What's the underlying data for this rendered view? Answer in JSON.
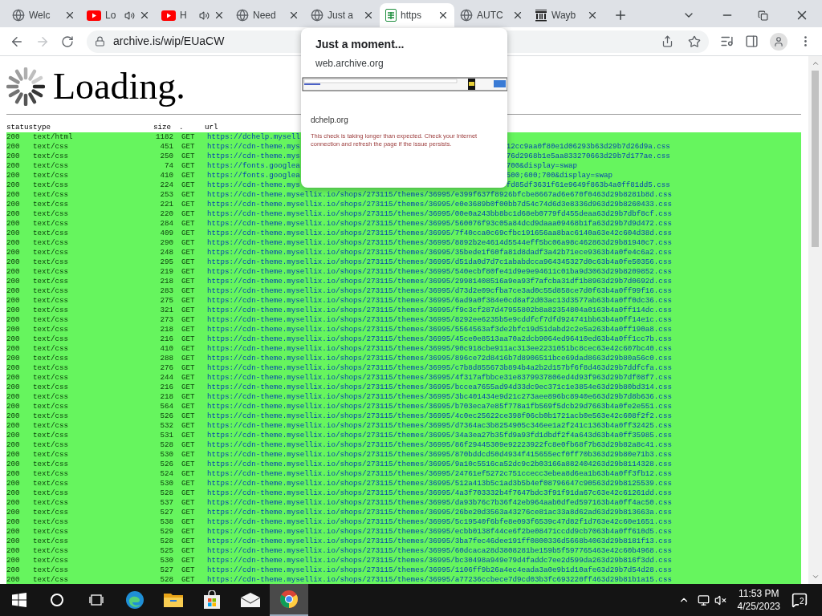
{
  "tabs": [
    {
      "title": "Welc",
      "kind": "globe",
      "audio": false,
      "selected": false
    },
    {
      "title": "Lo",
      "kind": "video",
      "audio": true,
      "selected": false
    },
    {
      "title": "H",
      "kind": "video",
      "audio": true,
      "selected": false
    },
    {
      "title": "Need",
      "kind": "globe",
      "audio": false,
      "selected": false
    },
    {
      "title": "Just a",
      "kind": "globe",
      "audio": false,
      "selected": false
    },
    {
      "title": "https",
      "kind": "sheet",
      "audio": false,
      "selected": true
    },
    {
      "title": "AUTC",
      "kind": "globe",
      "audio": false,
      "selected": false
    },
    {
      "title": "Wayb",
      "kind": "archive",
      "audio": false,
      "selected": false
    }
  ],
  "address_bar": {
    "url": "archive.is/wip/EUaCW"
  },
  "page": {
    "heading": "Loading.",
    "columns": [
      "status",
      "type",
      "size",
      ".",
      "url"
    ],
    "rows": [
      {
        "status": "200",
        "type": "text/html",
        "size": "1182",
        "method": "GET",
        "url": "https://dchelp.mysell"
      },
      {
        "status": "200",
        "type": "text/css",
        "size": "451",
        "method": "GET",
        "url": "https://cdn-theme.mys",
        "url_end": "12cc9aa0f80e1d06293b63d29b7d26d9a.css"
      },
      {
        "status": "200",
        "type": "text/css",
        "size": "250",
        "method": "GET",
        "url": "https://cdn-theme.mys",
        "url_end": "76d2968b1e5aa833270663d29b7d177ae.css"
      },
      {
        "status": "200",
        "type": "text/css",
        "size": "74",
        "method": "GET",
        "url": "https://fonts.googlea",
        "url_end": "700&display=swap"
      },
      {
        "status": "200",
        "type": "text/css",
        "size": "410",
        "method": "GET",
        "url": "https://fonts.googlea",
        "url_end": "500;600;700&display=swap"
      },
      {
        "status": "200",
        "type": "text/css",
        "size": "224",
        "method": "GET",
        "url": "https://cdn-theme.mys",
        "url_end": "fd85df3631f61e9649f863b4a0ff81dd5.css"
      },
      {
        "status": "200",
        "type": "text/css",
        "size": "253",
        "method": "GET",
        "url": "https://cdn-theme.mysellix.io/shops/273115/themes/36995/e399f637f8926bfcbe8667ad6e670f0463d29b8281b8d.css"
      },
      {
        "status": "200",
        "type": "text/css",
        "size": "221",
        "method": "GET",
        "url": "https://cdn-theme.mysellix.io/shops/273115/themes/36995/e0e3689b0f00bb7d54c74d6d3e8336d963d29b8260433.css"
      },
      {
        "status": "200",
        "type": "text/css",
        "size": "220",
        "method": "GET",
        "url": "https://cdn-theme.mysellix.io/shops/273115/themes/36995/00e0a243bb8bc1d68eb0779fd455deaa63d29b7dbf8cf.css"
      },
      {
        "status": "200",
        "type": "text/css",
        "size": "284",
        "method": "GET",
        "url": "https://cdn-theme.mysellix.io/shops/273115/themes/36995/560076f93c05a84dcd9daaa09468b1fa63d29b7d9d472.css"
      },
      {
        "status": "200",
        "type": "text/css",
        "size": "409",
        "method": "GET",
        "url": "https://cdn-theme.mysellix.io/shops/273115/themes/36995/7f40cca0c69cfbc191656aa8bac6140a63e42c604d38d.css"
      },
      {
        "status": "200",
        "type": "text/css",
        "size": "290",
        "method": "GET",
        "url": "https://cdn-theme.mysellix.io/shops/273115/themes/36995/8892b2e4614d5544eff5bc06a98c462863d29b81940c7.css"
      },
      {
        "status": "200",
        "type": "text/css",
        "size": "248",
        "method": "GET",
        "url": "https://cdn-theme.mysellix.io/shops/273115/themes/36995/35bede1f60fa81d8dadf3a42b71ece9363b4a0fe4c6a2.css"
      },
      {
        "status": "200",
        "type": "text/css",
        "size": "295",
        "method": "GET",
        "url": "https://cdn-theme.mysellix.io/shops/273115/themes/36995/d51da0d7d7c1ababdcca964345327d0c63b4a0fe50356.css"
      },
      {
        "status": "200",
        "type": "text/css",
        "size": "219",
        "method": "GET",
        "url": "https://cdn-theme.mysellix.io/shops/273115/themes/36995/540ecbf80fe41d9e9e94611c01ba9d3063d29b8209852.css"
      },
      {
        "status": "200",
        "type": "text/css",
        "size": "218",
        "method": "GET",
        "url": "https://cdn-theme.mysellix.io/shops/273115/themes/36995/29981408516a9ea93f7afcba31df1b8963d29b7d0692d.css"
      },
      {
        "status": "200",
        "type": "text/css",
        "size": "283",
        "method": "GET",
        "url": "https://cdn-theme.mysellix.io/shops/273115/themes/36995/d73d2e09cfba7ce3ad0c55d858ce7d0f63b4a0ff99f16.css"
      },
      {
        "status": "200",
        "type": "text/css",
        "size": "275",
        "method": "GET",
        "url": "https://cdn-theme.mysellix.io/shops/273115/themes/36995/6ad9a0f384e0cd8af2d03ac13d3577ab63b4a0ff0dc36.css"
      },
      {
        "status": "200",
        "type": "text/css",
        "size": "321",
        "method": "GET",
        "url": "https://cdn-theme.mysellix.io/shops/273115/themes/36995/f9c3cf287d47955802b8a82354804a0163b4a0ff114dc.css"
      },
      {
        "status": "200",
        "type": "text/css",
        "size": "273",
        "method": "GET",
        "url": "https://cdn-theme.mysellix.io/shops/273115/themes/36995/8292ee6235b5e9cddfcf7dfd924741bb63b4a0ff14e1c.css"
      },
      {
        "status": "200",
        "type": "text/css",
        "size": "218",
        "method": "GET",
        "url": "https://cdn-theme.mysellix.io/shops/273115/themes/36995/5564563af3de2bfc19d51dabd2c2e5a263b4a0ff190a8.css"
      },
      {
        "status": "200",
        "type": "text/css",
        "size": "216",
        "method": "GET",
        "url": "https://cdn-theme.mysellix.io/shops/273115/themes/36995/45ce0e8513aa70a2dcb9064ed96410ed63b4a0ff1cc7b.css"
      },
      {
        "status": "200",
        "type": "text/css",
        "size": "410",
        "method": "GET",
        "url": "https://cdn-theme.mysellix.io/shops/273115/themes/36995/90c918cbe911ac313ee2231051bc8cec63e42c607bc40.css"
      },
      {
        "status": "200",
        "type": "text/css",
        "size": "288",
        "method": "GET",
        "url": "https://cdn-theme.mysellix.io/shops/273115/themes/36995/896ce72d8416b7d8906511bce69dad8663d29b80a56c0.css"
      },
      {
        "status": "200",
        "type": "text/css",
        "size": "276",
        "method": "GET",
        "url": "https://cdn-theme.mysellix.io/shops/273115/themes/36995/c7b8d855673b894b4a2b2d157bf6f8d463d29b7ddfcfa.css"
      },
      {
        "status": "200",
        "type": "text/css",
        "size": "244",
        "method": "GET",
        "url": "https://cdn-theme.mysellix.io/shops/273115/themes/36995/4f317afbbce31e8379937806ed4d93f963d29b7df08f7.css"
      },
      {
        "status": "200",
        "type": "text/css",
        "size": "216",
        "method": "GET",
        "url": "https://cdn-theme.mysellix.io/shops/273115/themes/36995/bccea7655ad94d33dc9ec371c1e3854e63d29b80bd314.css"
      },
      {
        "status": "200",
        "type": "text/css",
        "size": "218",
        "method": "GET",
        "url": "https://cdn-theme.mysellix.io/shops/273115/themes/36995/3bc401434e9d21c273aee896bc8940e663d29b7d8b636.css"
      },
      {
        "status": "200",
        "type": "text/css",
        "size": "564",
        "method": "GET",
        "url": "https://cdn-theme.mysellix.io/shops/273115/themes/36995/b703eca7e85f778a1fb569f5dcb29d7663b4a0fe2e551.css"
      },
      {
        "status": "200",
        "type": "text/css",
        "size": "526",
        "method": "GET",
        "url": "https://cdn-theme.mysellix.io/shops/273115/themes/36995/4c0ec25622ce398f06cb0b1721acb0e563e42c608f2f2.css"
      },
      {
        "status": "200",
        "type": "text/css",
        "size": "532",
        "method": "GET",
        "url": "https://cdn-theme.mysellix.io/shops/273115/themes/36995/d7364ac3b8254905c346ee1a2f241c1363b4a0ff32425.css"
      },
      {
        "status": "200",
        "type": "text/css",
        "size": "531",
        "method": "GET",
        "url": "https://cdn-theme.mysellix.io/shops/273115/themes/36995/34a3ea27b35fd9a93fd1dbdf2f4a643d63b4a0ff35985.css"
      },
      {
        "status": "200",
        "type": "text/css",
        "size": "528",
        "method": "GET",
        "url": "https://cdn-theme.mysellix.io/shops/273115/themes/36995/86f29445309e92223922fc8e0fb68f7b63d29b82a8c41.css"
      },
      {
        "status": "200",
        "type": "text/css",
        "size": "530",
        "method": "GET",
        "url": "https://cdn-theme.mysellix.io/shops/273115/themes/36995/870bddcd50d4934f415655ecf0ff70b363d29b80e71b3.css"
      },
      {
        "status": "200",
        "type": "text/css",
        "size": "526",
        "method": "GET",
        "url": "https://cdn-theme.mysellix.io/shops/273115/themes/36995/9a10c5516ca52dc9c2b03166a882404263d29b8114328.css"
      },
      {
        "status": "200",
        "type": "text/css",
        "size": "524",
        "method": "GET",
        "url": "https://cdn-theme.mysellix.io/shops/273115/themes/36995/24761ef5272c751ccecc3ebea8d6ea1b63b4a0ff3fb12.css"
      },
      {
        "status": "200",
        "type": "text/css",
        "size": "530",
        "method": "GET",
        "url": "https://cdn-theme.mysellix.io/shops/273115/themes/36995/512a413b5c1ad3b5b4ef08796647c90563d29b8125539.css"
      },
      {
        "status": "200",
        "type": "text/css",
        "size": "528",
        "method": "GET",
        "url": "https://cdn-theme.mysellix.io/shops/273115/themes/36995/4a3f703332b4f7647bdc3f91f91da67c63e42c61261dd.css"
      },
      {
        "status": "200",
        "type": "text/css",
        "size": "537",
        "method": "GET",
        "url": "https://cdn-theme.mysellix.io/shops/273115/themes/36995/da93b76c7b36f42eb964aab0dfed597163b4a0ff4ac50.css"
      },
      {
        "status": "200",
        "type": "text/css",
        "size": "527",
        "method": "GET",
        "url": "https://cdn-theme.mysellix.io/shops/273115/themes/36995/26be20d3563a43276ce81ac33a8d62ad63d29b813663a.css"
      },
      {
        "status": "200",
        "type": "text/css",
        "size": "538",
        "method": "GET",
        "url": "https://cdn-theme.mysellix.io/shops/273115/themes/36995/5c19540f6bfe8e093f6539c47d82f1d763e42c60e1651.css"
      },
      {
        "status": "200",
        "type": "text/css",
        "size": "529",
        "method": "GET",
        "url": "https://cdn-theme.mysellix.io/shops/273115/themes/36995/ecbb0138f44ce6f2be08471ccdd9cb7063b4a0ff610d5.css"
      },
      {
        "status": "200",
        "type": "text/css",
        "size": "528",
        "method": "GET",
        "url": "https://cdn-theme.mysellix.io/shops/273115/themes/36995/3ba7fec46dee191ff0800336d5668b4063d29b8181f13.css"
      },
      {
        "status": "200",
        "type": "text/css",
        "size": "525",
        "method": "GET",
        "url": "https://cdn-theme.mysellix.io/shops/273115/themes/36995/60dcaca28d3808281be159b5f597765463e42c60b4968.css"
      },
      {
        "status": "200",
        "type": "text/css",
        "size": "530",
        "method": "GET",
        "url": "https://cdn-theme.mysellix.io/shops/273115/themes/36995/bc30498a949e79d4faddc7ee2d599da263d29b816f3dd.css"
      },
      {
        "status": "200",
        "type": "text/css",
        "size": "527",
        "method": "GET",
        "url": "https://cdn-theme.mysellix.io/shops/273115/themes/36995/1106ff9b26a4ec4eada3a0e9b1d10afe63d29b7d54d28.css"
      },
      {
        "status": "200",
        "type": "text/css",
        "size": "528",
        "method": "GET",
        "url": "https://cdn-theme.mysellix.io/shops/273115/themes/36995/a77236ccbece7d9cd03b3fc693220ff463d29b81b1a15.css"
      }
    ]
  },
  "tab_hover_card": {
    "title": "Just a moment...",
    "domain": "web.archive.org",
    "site": "dchelp.org",
    "message": "This check is taking longer than expected. Check your Internet connection and refresh the page if the issue persists."
  },
  "taskbar": {
    "apps": [
      {
        "kind": "edge",
        "selected": false
      },
      {
        "kind": "folder",
        "selected": false
      },
      {
        "kind": "store",
        "selected": false
      },
      {
        "kind": "mail",
        "selected": false
      },
      {
        "kind": "chrome",
        "selected": true
      }
    ],
    "time": "11:53 PM",
    "date": "4/25/2023",
    "notifications": "2"
  }
}
